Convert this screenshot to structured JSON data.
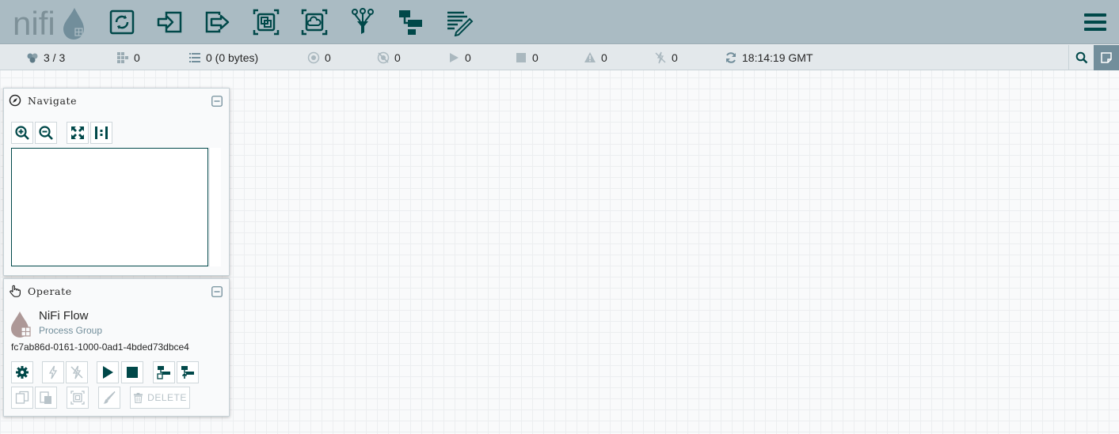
{
  "app": {
    "logo_text": "nifi"
  },
  "toolbar": {
    "tools": [
      {
        "name": "processor-tool",
        "icon": "processor-icon"
      },
      {
        "name": "input-port-tool",
        "icon": "input-port-icon"
      },
      {
        "name": "output-port-tool",
        "icon": "output-port-icon"
      },
      {
        "name": "process-group-tool",
        "icon": "process-group-icon"
      },
      {
        "name": "remote-process-group-tool",
        "icon": "remote-group-icon"
      },
      {
        "name": "funnel-tool",
        "icon": "funnel-icon"
      },
      {
        "name": "template-tool",
        "icon": "template-icon"
      },
      {
        "name": "label-tool",
        "icon": "label-icon"
      }
    ],
    "menu_icon": "hamburger-icon"
  },
  "status": {
    "cluster": "3 / 3",
    "threads": "0",
    "queued": "0 (0 bytes)",
    "transmitting": "0",
    "not_transmitting": "0",
    "running": "0",
    "stopped": "0",
    "invalid": "0",
    "disabled": "0",
    "refresh_time": "18:14:19 GMT"
  },
  "navigate": {
    "title": "Navigate"
  },
  "operate": {
    "title": "Operate",
    "pg_name": "NiFi Flow",
    "pg_type": "Process Group",
    "pg_id": "fc7ab86d-0161-1000-0ad1-4bded73dbce4",
    "delete_label": "DELETE"
  },
  "colors": {
    "header_bg": "#aabbc3",
    "icon_dark": "#004849",
    "status_bg": "#e3e8eb",
    "accent": "#728e9b",
    "logo_drop": "#ad9897"
  }
}
